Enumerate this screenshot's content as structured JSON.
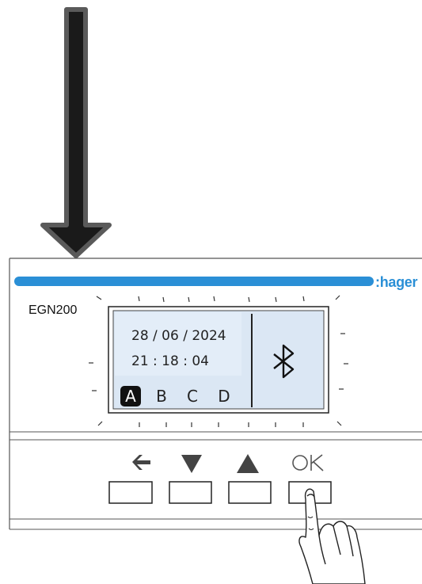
{
  "device": {
    "brand": ":hager",
    "model": "EGN200"
  },
  "display": {
    "date": "28 / 06 / 2024",
    "time": "21 : 18 : 04",
    "channels": [
      "A",
      "B",
      "C",
      "D"
    ],
    "active_channel": "A",
    "status_icon": "bluetooth-icon"
  },
  "buttons": [
    {
      "icon": "arrow-left-icon",
      "label": ""
    },
    {
      "icon": "triangle-down-icon",
      "label": ""
    },
    {
      "icon": "triangle-up-icon",
      "label": ""
    },
    {
      "icon": "ok-text",
      "label": "OK",
      "pressed": true
    }
  ],
  "annotation": {
    "icon": "arrow-down-icon"
  },
  "colors": {
    "brand_stripe": "#2a8fd6",
    "screen_background": "#dbe7f4",
    "arrow_fill": "#1a1a1a",
    "arrow_outline": "#555555"
  }
}
